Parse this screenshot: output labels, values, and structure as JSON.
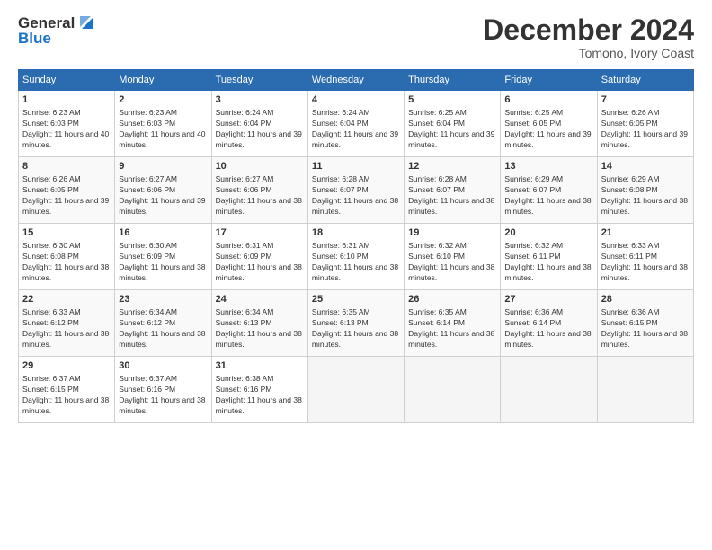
{
  "logo": {
    "line1": "General",
    "line2": "Blue"
  },
  "title": "December 2024",
  "location": "Tomono, Ivory Coast",
  "weekdays": [
    "Sunday",
    "Monday",
    "Tuesday",
    "Wednesday",
    "Thursday",
    "Friday",
    "Saturday"
  ],
  "weeks": [
    [
      {
        "day": "1",
        "sunrise": "6:23 AM",
        "sunset": "6:03 PM",
        "daylight": "11 hours and 40 minutes."
      },
      {
        "day": "2",
        "sunrise": "6:23 AM",
        "sunset": "6:03 PM",
        "daylight": "11 hours and 40 minutes."
      },
      {
        "day": "3",
        "sunrise": "6:24 AM",
        "sunset": "6:04 PM",
        "daylight": "11 hours and 39 minutes."
      },
      {
        "day": "4",
        "sunrise": "6:24 AM",
        "sunset": "6:04 PM",
        "daylight": "11 hours and 39 minutes."
      },
      {
        "day": "5",
        "sunrise": "6:25 AM",
        "sunset": "6:04 PM",
        "daylight": "11 hours and 39 minutes."
      },
      {
        "day": "6",
        "sunrise": "6:25 AM",
        "sunset": "6:05 PM",
        "daylight": "11 hours and 39 minutes."
      },
      {
        "day": "7",
        "sunrise": "6:26 AM",
        "sunset": "6:05 PM",
        "daylight": "11 hours and 39 minutes."
      }
    ],
    [
      {
        "day": "8",
        "sunrise": "6:26 AM",
        "sunset": "6:05 PM",
        "daylight": "11 hours and 39 minutes."
      },
      {
        "day": "9",
        "sunrise": "6:27 AM",
        "sunset": "6:06 PM",
        "daylight": "11 hours and 39 minutes."
      },
      {
        "day": "10",
        "sunrise": "6:27 AM",
        "sunset": "6:06 PM",
        "daylight": "11 hours and 38 minutes."
      },
      {
        "day": "11",
        "sunrise": "6:28 AM",
        "sunset": "6:07 PM",
        "daylight": "11 hours and 38 minutes."
      },
      {
        "day": "12",
        "sunrise": "6:28 AM",
        "sunset": "6:07 PM",
        "daylight": "11 hours and 38 minutes."
      },
      {
        "day": "13",
        "sunrise": "6:29 AM",
        "sunset": "6:07 PM",
        "daylight": "11 hours and 38 minutes."
      },
      {
        "day": "14",
        "sunrise": "6:29 AM",
        "sunset": "6:08 PM",
        "daylight": "11 hours and 38 minutes."
      }
    ],
    [
      {
        "day": "15",
        "sunrise": "6:30 AM",
        "sunset": "6:08 PM",
        "daylight": "11 hours and 38 minutes."
      },
      {
        "day": "16",
        "sunrise": "6:30 AM",
        "sunset": "6:09 PM",
        "daylight": "11 hours and 38 minutes."
      },
      {
        "day": "17",
        "sunrise": "6:31 AM",
        "sunset": "6:09 PM",
        "daylight": "11 hours and 38 minutes."
      },
      {
        "day": "18",
        "sunrise": "6:31 AM",
        "sunset": "6:10 PM",
        "daylight": "11 hours and 38 minutes."
      },
      {
        "day": "19",
        "sunrise": "6:32 AM",
        "sunset": "6:10 PM",
        "daylight": "11 hours and 38 minutes."
      },
      {
        "day": "20",
        "sunrise": "6:32 AM",
        "sunset": "6:11 PM",
        "daylight": "11 hours and 38 minutes."
      },
      {
        "day": "21",
        "sunrise": "6:33 AM",
        "sunset": "6:11 PM",
        "daylight": "11 hours and 38 minutes."
      }
    ],
    [
      {
        "day": "22",
        "sunrise": "6:33 AM",
        "sunset": "6:12 PM",
        "daylight": "11 hours and 38 minutes."
      },
      {
        "day": "23",
        "sunrise": "6:34 AM",
        "sunset": "6:12 PM",
        "daylight": "11 hours and 38 minutes."
      },
      {
        "day": "24",
        "sunrise": "6:34 AM",
        "sunset": "6:13 PM",
        "daylight": "11 hours and 38 minutes."
      },
      {
        "day": "25",
        "sunrise": "6:35 AM",
        "sunset": "6:13 PM",
        "daylight": "11 hours and 38 minutes."
      },
      {
        "day": "26",
        "sunrise": "6:35 AM",
        "sunset": "6:14 PM",
        "daylight": "11 hours and 38 minutes."
      },
      {
        "day": "27",
        "sunrise": "6:36 AM",
        "sunset": "6:14 PM",
        "daylight": "11 hours and 38 minutes."
      },
      {
        "day": "28",
        "sunrise": "6:36 AM",
        "sunset": "6:15 PM",
        "daylight": "11 hours and 38 minutes."
      }
    ],
    [
      {
        "day": "29",
        "sunrise": "6:37 AM",
        "sunset": "6:15 PM",
        "daylight": "11 hours and 38 minutes."
      },
      {
        "day": "30",
        "sunrise": "6:37 AM",
        "sunset": "6:16 PM",
        "daylight": "11 hours and 38 minutes."
      },
      {
        "day": "31",
        "sunrise": "6:38 AM",
        "sunset": "6:16 PM",
        "daylight": "11 hours and 38 minutes."
      },
      null,
      null,
      null,
      null
    ]
  ]
}
